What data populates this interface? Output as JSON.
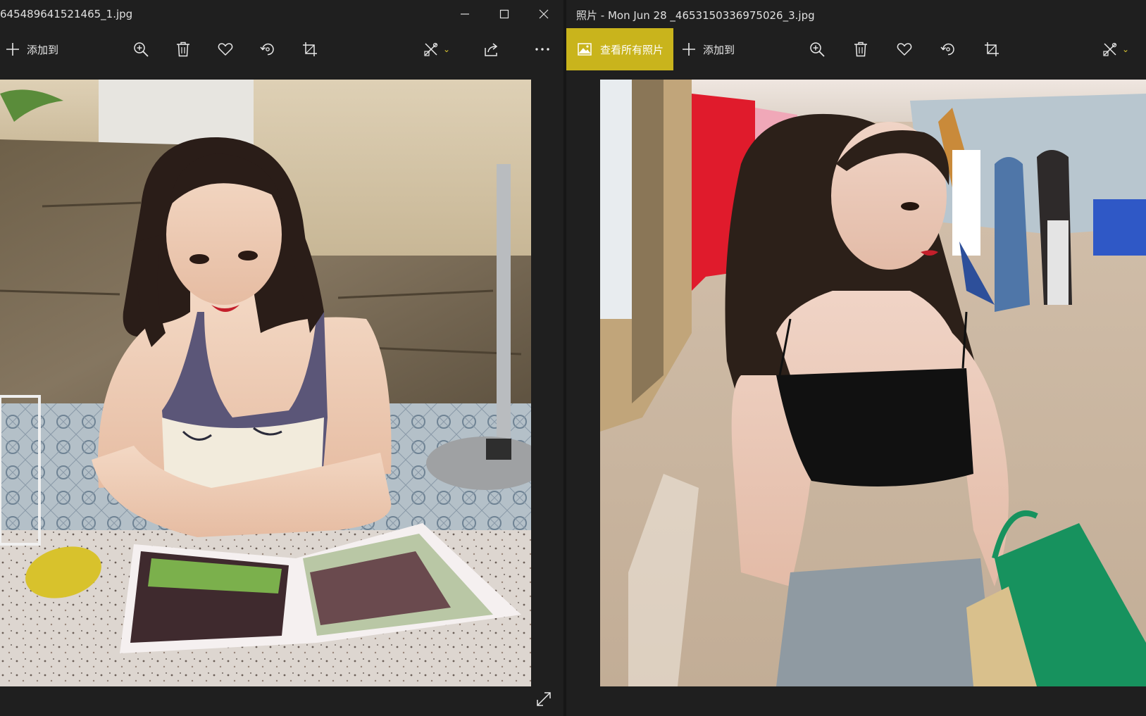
{
  "left_window": {
    "title": "645489641521465_1.jpg",
    "toolbar": {
      "add_label": "添加到"
    }
  },
  "right_window": {
    "title": "照片 - Mon Jun 28 _4653150336975026_3.jpg",
    "toolbar": {
      "view_all_label": "查看所有照片",
      "add_label": "添加到"
    }
  },
  "colors": {
    "accent": "#c9b41c",
    "background": "#1f1f1f",
    "icon": "#e8e8e8"
  },
  "icons": [
    "plus-icon",
    "zoom-in-icon",
    "delete-icon",
    "heart-icon",
    "rotate-icon",
    "crop-icon",
    "edit-icon",
    "share-icon",
    "more-icon",
    "minimize-icon",
    "maximize-icon",
    "close-icon",
    "expand-icon",
    "photo-icon"
  ]
}
